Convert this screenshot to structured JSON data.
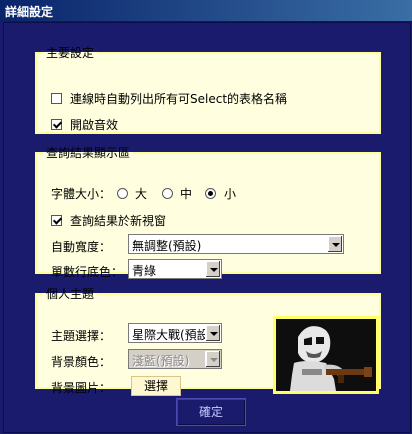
{
  "window": {
    "title": "詳細設定"
  },
  "main_settings": {
    "legend": "主要設定",
    "options": [
      {
        "label": "連線時自動列出所有可Select的表格名稱",
        "checked": false
      },
      {
        "label": "開啟音效",
        "checked": true
      }
    ]
  },
  "results_display": {
    "legend": "查詢結果顯示區",
    "font_size_label": "字體大小：",
    "font_sizes": [
      {
        "label": "大",
        "selected": false
      },
      {
        "label": "中",
        "selected": false
      },
      {
        "label": "小",
        "selected": true
      }
    ],
    "new_window_label": "查詢結果於新視窗",
    "new_window_checked": true,
    "auto_width_label": "自動寬度：",
    "auto_width_value": "無調整(預設)",
    "odd_row_color_label": "單數行底色：",
    "odd_row_color_value": "青綠"
  },
  "personal_theme": {
    "legend": "個人主題",
    "theme_label": "主題選擇：",
    "theme_value": "星際大戰(預設)",
    "bg_color_label": "背景顏色：",
    "bg_color_value": "淺藍(預設)",
    "bg_image_label": "背景圖片：",
    "choose_button_label": "選擇",
    "preview_icon": "stormtrooper-image"
  },
  "footer": {
    "ok_label": "確定"
  },
  "colors": {
    "window_background": "#1b1b6e",
    "panel_background": "#ffffdf",
    "panel_border": "#ffff99",
    "title_gradient_start": "#0a246a"
  }
}
